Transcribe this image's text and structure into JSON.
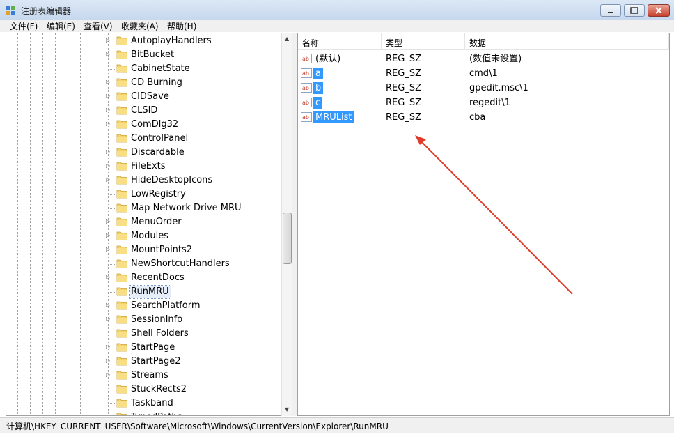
{
  "window": {
    "title": "注册表编辑器"
  },
  "menu": [
    "文件(F)",
    "编辑(E)",
    "查看(V)",
    "收藏夹(A)",
    "帮助(H)"
  ],
  "tree": {
    "items": [
      {
        "label": "AutoplayHandlers",
        "expandable": true
      },
      {
        "label": "BitBucket",
        "expandable": true
      },
      {
        "label": "CabinetState",
        "expandable": false
      },
      {
        "label": "CD Burning",
        "expandable": true
      },
      {
        "label": "CIDSave",
        "expandable": true
      },
      {
        "label": "CLSID",
        "expandable": true
      },
      {
        "label": "ComDlg32",
        "expandable": true
      },
      {
        "label": "ControlPanel",
        "expandable": false
      },
      {
        "label": "Discardable",
        "expandable": true
      },
      {
        "label": "FileExts",
        "expandable": true
      },
      {
        "label": "HideDesktopIcons",
        "expandable": true
      },
      {
        "label": "LowRegistry",
        "expandable": false
      },
      {
        "label": "Map Network Drive MRU",
        "expandable": false
      },
      {
        "label": "MenuOrder",
        "expandable": true
      },
      {
        "label": "Modules",
        "expandable": true
      },
      {
        "label": "MountPoints2",
        "expandable": true
      },
      {
        "label": "NewShortcutHandlers",
        "expandable": false
      },
      {
        "label": "RecentDocs",
        "expandable": true
      },
      {
        "label": "RunMRU",
        "expandable": false,
        "selected": true
      },
      {
        "label": "SearchPlatform",
        "expandable": true
      },
      {
        "label": "SessionInfo",
        "expandable": true
      },
      {
        "label": "Shell Folders",
        "expandable": false
      },
      {
        "label": "StartPage",
        "expandable": true
      },
      {
        "label": "StartPage2",
        "expandable": true
      },
      {
        "label": "Streams",
        "expandable": true
      },
      {
        "label": "StuckRects2",
        "expandable": false
      },
      {
        "label": "Taskband",
        "expandable": false
      },
      {
        "label": "TypedPaths",
        "expandable": false
      }
    ]
  },
  "list": {
    "columns": [
      "名称",
      "类型",
      "数据"
    ],
    "rows": [
      {
        "icon": "string-value-icon",
        "name": "(默认)",
        "type": "REG_SZ",
        "data": "(数值未设置)",
        "highlight": false
      },
      {
        "icon": "string-value-icon",
        "name": "a",
        "type": "REG_SZ",
        "data": "cmd\\1",
        "highlight": true
      },
      {
        "icon": "string-value-icon",
        "name": "b",
        "type": "REG_SZ",
        "data": "gpedit.msc\\1",
        "highlight": true
      },
      {
        "icon": "string-value-icon",
        "name": "c",
        "type": "REG_SZ",
        "data": "regedit\\1",
        "highlight": true
      },
      {
        "icon": "string-value-icon",
        "name": "MRUList",
        "type": "REG_SZ",
        "data": "cba",
        "highlight": true
      }
    ]
  },
  "status": {
    "path": "计算机\\HKEY_CURRENT_USER\\Software\\Microsoft\\Windows\\CurrentVersion\\Explorer\\RunMRU"
  },
  "colors": {
    "selection": "#3399ff",
    "annotation_arrow": "#e03c2b"
  }
}
